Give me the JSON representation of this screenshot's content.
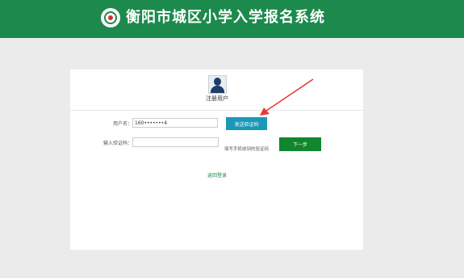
{
  "header": {
    "title": "衡阳市城区小学入学报名系统",
    "logo_icon": "school-emblem-icon",
    "background": "#1c8a4c"
  },
  "form": {
    "title": "注册用户",
    "avatar_icon": "user-avatar-icon",
    "username_label": "用户名：",
    "username_value": "160•••••••4",
    "code_label": "输入验证码：",
    "code_value": "",
    "send_code_label": "发送验证码",
    "code_hint": "填写手机收到的验证码",
    "next_label": "下一步",
    "back_to_login": "返回登录"
  },
  "colors": {
    "send_button": "#1c98b7",
    "next_button": "#11862d",
    "annotation_arrow": "#e53935"
  }
}
